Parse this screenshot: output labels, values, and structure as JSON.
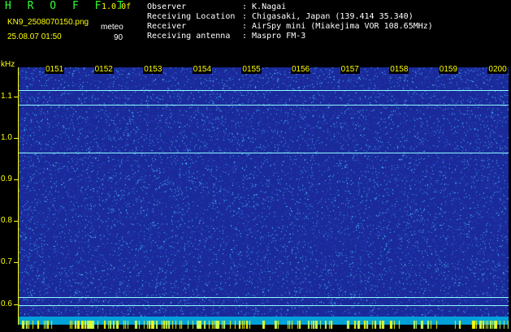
{
  "header": {
    "title": "H R O F F T",
    "version": "1.0.0f",
    "filename": "KN9_2508070150.png",
    "datetime": "25.08.07 01:50",
    "meteor_label": "meteo",
    "meteor_value": "90",
    "observer_label": "Observer",
    "observer_value": ": K.Nagai",
    "location_label": "Receiving Location",
    "location_value": ": Chigasaki, Japan (139.414 35.340)",
    "receiver_label": "Receiver",
    "receiver_value": ": AirSpy mini (Miakejima VOR 108.65MHz)",
    "antenna_label": "Receiving antenna",
    "antenna_value": ": Maspro FM-3"
  },
  "spectrogram": {
    "unit": "kHz",
    "time_labels": [
      "0151",
      "0152",
      "0153",
      "0154",
      "0155",
      "0156",
      "0157",
      "0158",
      "0159",
      "0200"
    ],
    "freq_labels": [
      "1.1",
      "1.0",
      "0.9",
      "0.8",
      "0.7",
      "0.6"
    ],
    "trace_freqs_khz": [
      1.115,
      1.08,
      0.965,
      0.617,
      0.598
    ],
    "freq_range_khz": [
      0.57,
      1.17
    ],
    "colors": {
      "background": "#1a2a9a",
      "noise": "#4fd0ff",
      "trace": "#8ff8ff",
      "label": "#ffff00",
      "bottom": "#00a0d8"
    }
  }
}
